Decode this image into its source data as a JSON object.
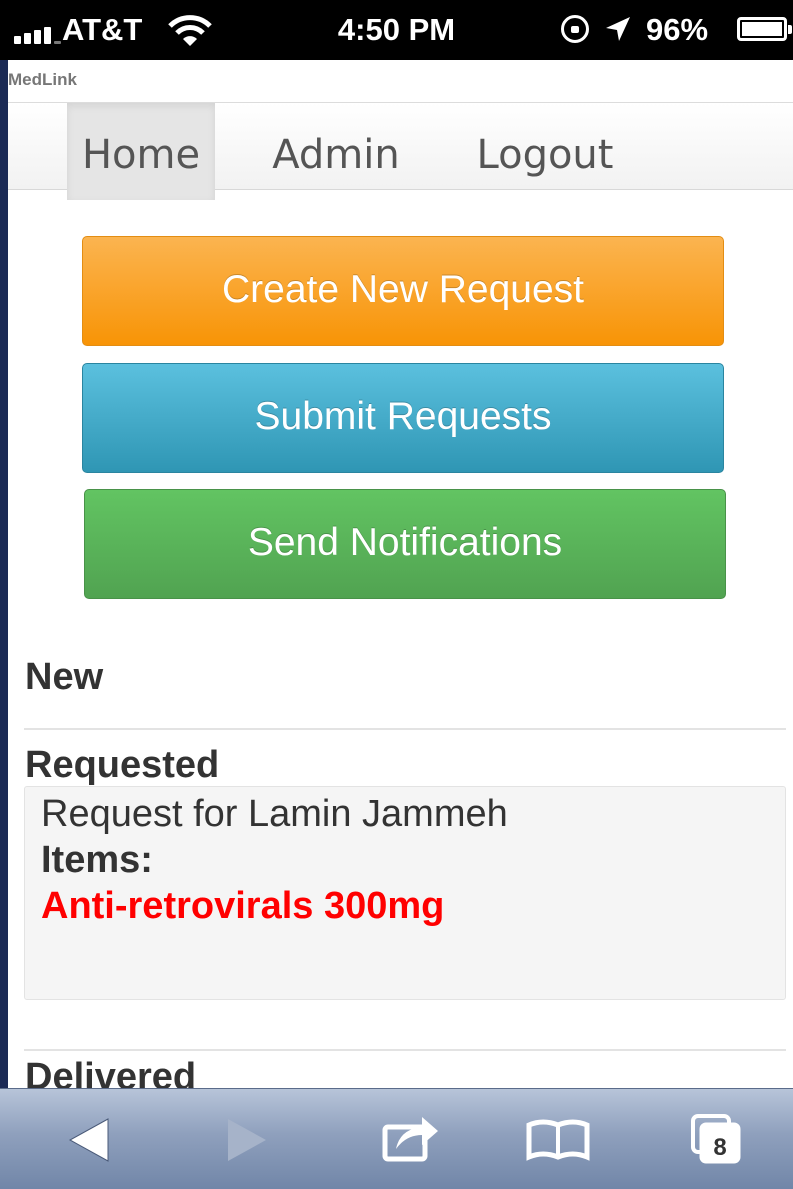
{
  "status_bar": {
    "carrier": "AT&T",
    "time": "4:50 PM",
    "battery_percent": "96%"
  },
  "page": {
    "title": "MedLink",
    "nav": {
      "home": "Home",
      "admin": "Admin",
      "logout": "Logout"
    },
    "actions": {
      "create": "Create New Request",
      "submit": "Submit Requests",
      "notify": "Send Notifications"
    },
    "sections": {
      "new": "New",
      "requested": "Requested",
      "delivered": "Delivered"
    },
    "requested_items": [
      {
        "title": "Request for Lamin Jammeh",
        "items_label": "Items:",
        "item": "Anti-retrovirals 300mg"
      }
    ]
  },
  "toolbar": {
    "tab_count": "8"
  },
  "colors": {
    "create_button": "#f89406",
    "submit_button": "#2f96b4",
    "notify_button": "#51a351",
    "item_text": "#ff0000"
  }
}
